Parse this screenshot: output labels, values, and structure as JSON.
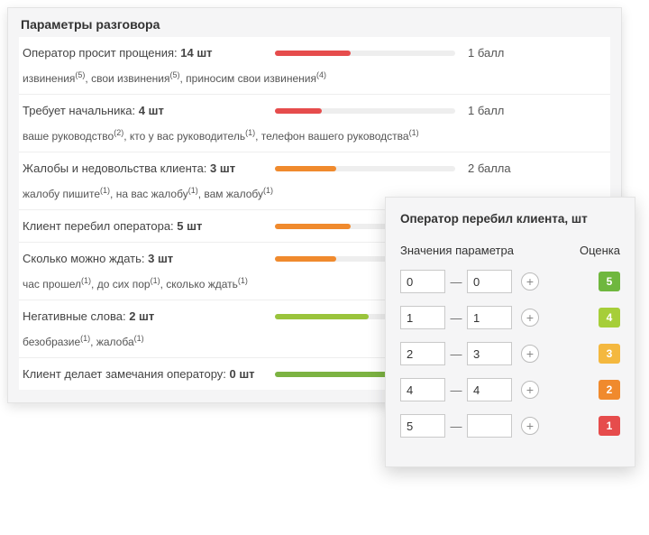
{
  "panel": {
    "title": "Параметры разговора",
    "rows": [
      {
        "label": "Оператор просит прощения:",
        "count": "14 шт",
        "barColor": "#e64c4c",
        "barPct": 42,
        "score": "1 балл",
        "phrases": [
          {
            "text": "извинения",
            "sup": "(5)"
          },
          {
            "text": "свои извинения",
            "sup": "(5)"
          },
          {
            "text": "приносим свои извинения",
            "sup": "(4)"
          }
        ]
      },
      {
        "label": "Требует начальника:",
        "count": "4 шт",
        "barColor": "#e64c4c",
        "barPct": 26,
        "score": "1 балл",
        "phrases": [
          {
            "text": "ваше руководство",
            "sup": "(2)"
          },
          {
            "text": "кто у вас руководитель",
            "sup": "(1)"
          },
          {
            "text": "телефон вашего руководства",
            "sup": "(1)"
          }
        ]
      },
      {
        "label": "Жалобы и недовольства клиента:",
        "count": "3 шт",
        "barColor": "#f08a2d",
        "barPct": 34,
        "score": "2 балла",
        "phrases": [
          {
            "text": "жалобу пишите",
            "sup": "(1)"
          },
          {
            "text": "на вас жалобу",
            "sup": "(1)"
          },
          {
            "text": "вам жалобу",
            "sup": "(1)"
          }
        ]
      },
      {
        "label": "Клиент перебил оператора:",
        "count": "5 шт",
        "barColor": "#f08a2d",
        "barPct": 42,
        "score": "",
        "phrases": []
      },
      {
        "label": "Сколько можно ждать:",
        "count": "3 шт",
        "barColor": "#f08a2d",
        "barPct": 34,
        "score": "",
        "phrases": [
          {
            "text": "час прошел",
            "sup": "(1)"
          },
          {
            "text": "до сих пор",
            "sup": "(1)"
          },
          {
            "text": "сколько ждать",
            "sup": "(1)"
          }
        ]
      },
      {
        "label": "Негативные слова:",
        "count": "2 шт",
        "barColor": "#9ac43c",
        "barPct": 52,
        "score": "",
        "phrases": [
          {
            "text": "безобразие",
            "sup": "(1)"
          },
          {
            "text": "жалоба",
            "sup": "(1)"
          }
        ]
      },
      {
        "label": "Клиент делает замечания оператору:",
        "count": "0 шт",
        "barColor": "#7cb342",
        "barPct": 100,
        "score": "",
        "phrases": []
      }
    ]
  },
  "popup": {
    "title": "Оператор перебил клиента, шт",
    "header_values": "Значения параметра",
    "header_score": "Оценка",
    "dash": "—",
    "plus": "+",
    "rules": [
      {
        "from": "0",
        "to": "0",
        "badge": "5",
        "color": "#6fb73e"
      },
      {
        "from": "1",
        "to": "1",
        "badge": "4",
        "color": "#a6ce39"
      },
      {
        "from": "2",
        "to": "3",
        "badge": "3",
        "color": "#f4b83f"
      },
      {
        "from": "4",
        "to": "4",
        "badge": "2",
        "color": "#f08a2d"
      },
      {
        "from": "5",
        "to": "",
        "badge": "1",
        "color": "#e64c4c"
      }
    ]
  }
}
